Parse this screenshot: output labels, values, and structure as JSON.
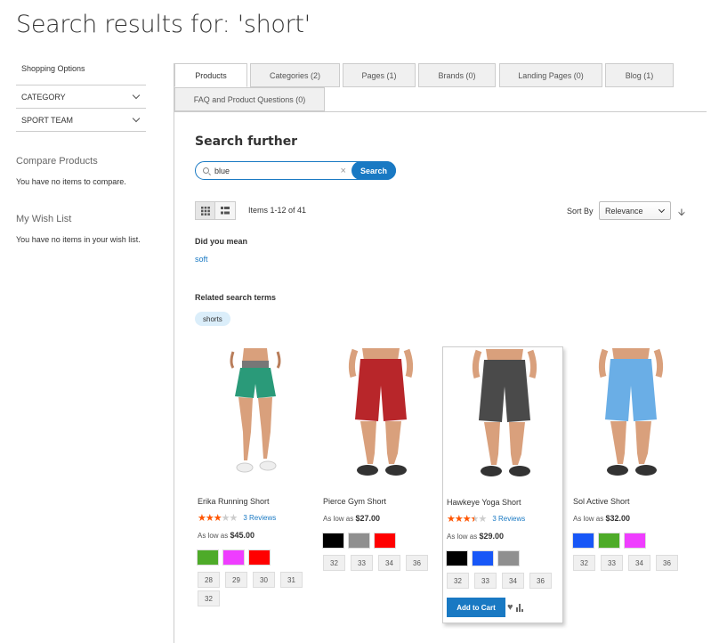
{
  "page": {
    "title": "Search results for: 'short'"
  },
  "sidebar": {
    "shopping_options": "Shopping Options",
    "filters": [
      "CATEGORY",
      "SPORT TEAM"
    ],
    "compare_title": "Compare Products",
    "compare_text": "You have no items to compare.",
    "wishlist_title": "My Wish List",
    "wishlist_text": "You have no items in your wish list."
  },
  "tabs": [
    "Products",
    "Categories (2)",
    "Pages (1)",
    "Brands (0)",
    "Landing Pages (0)",
    "Blog (1)",
    "FAQ and Product Questions (0)"
  ],
  "search": {
    "heading": "Search further",
    "value": "blue",
    "clear": "×",
    "button": "Search"
  },
  "toolbar": {
    "items_count": "Items 1-12 of 41",
    "sort_label": "Sort By",
    "sort_value": "Relevance"
  },
  "did_you_mean": {
    "label": "Did you mean",
    "suggestion": "soft"
  },
  "related": {
    "label": "Related search terms",
    "terms": [
      "shorts"
    ]
  },
  "products": [
    {
      "name": "Erika Running Short",
      "rating": 3,
      "reviews": "3  Reviews",
      "price_prefix": "As low as",
      "price": "$45.00",
      "colors": [
        "#4eab29",
        "#ef3dff",
        "#ff0000"
      ],
      "sizes": [
        "28",
        "29",
        "30",
        "31",
        "32"
      ],
      "shorts_color": "#2a9a79",
      "gender": "female"
    },
    {
      "name": "Pierce Gym Short",
      "rating": 0,
      "reviews": "",
      "price_prefix": "As low as",
      "price": "$27.00",
      "colors": [
        "#000000",
        "#8f8f8f",
        "#ff0000"
      ],
      "sizes": [
        "32",
        "33",
        "34",
        "36"
      ],
      "shorts_color": "#b8262a",
      "gender": "male"
    },
    {
      "name": "Hawkeye Yoga Short",
      "rating": 3.5,
      "reviews": "3  Reviews",
      "price_prefix": "As low as",
      "price": "$29.00",
      "colors": [
        "#000000",
        "#1857f7",
        "#8f8f8f"
      ],
      "sizes": [
        "32",
        "33",
        "34",
        "36"
      ],
      "shorts_color": "#4a4a4a",
      "gender": "male",
      "add_to_cart": "Add to Cart"
    },
    {
      "name": "Sol Active Short",
      "rating": 0,
      "reviews": "",
      "price_prefix": "As low as",
      "price": "$32.00",
      "colors": [
        "#1857f7",
        "#4eab29",
        "#ef3dff"
      ],
      "sizes": [
        "32",
        "33",
        "34",
        "36"
      ],
      "shorts_color": "#6aaee6",
      "gender": "male"
    }
  ]
}
